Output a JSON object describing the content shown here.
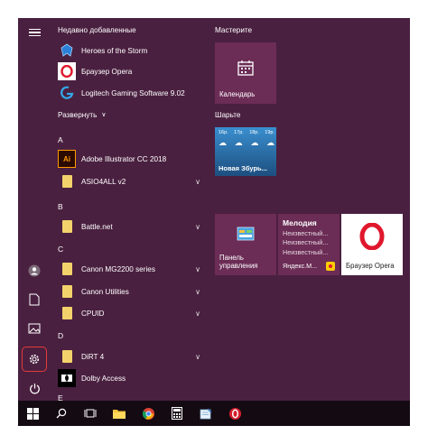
{
  "recent": {
    "title": "Недавно добавленные",
    "items": [
      {
        "label": "Heroes of the Storm",
        "icon": "heroes-of-the-storm-icon"
      },
      {
        "label": "Браузер Opera",
        "icon": "opera-icon"
      },
      {
        "label": "Logitech Gaming Software 9.02",
        "icon": "logitech-icon"
      }
    ]
  },
  "expand_label": "Развернуть",
  "sections": {
    "a": "A",
    "b": "B",
    "c": "C",
    "d": "D",
    "e": "E"
  },
  "apps": {
    "illustrator": "Adobe Illustrator CC 2018",
    "asio": "ASIO4ALL v2",
    "battlenet": "Battle.net",
    "canon_mg": "Canon MG2200 series",
    "canon_util": "Canon Utilities",
    "cpuid": "CPUID",
    "dirt": "DiRT 4",
    "dolby": "Dolby Access"
  },
  "groups": {
    "masterite": "Мастерите",
    "sharyte": "Шарьте"
  },
  "tiles": {
    "calendar": "Календарь",
    "weather_place": "Новая Збурь...",
    "weather_days": [
      "16р.",
      "17р.",
      "18р.",
      "19р."
    ],
    "control_panel": "Панель управления",
    "opera": "Браузер Opera",
    "music_title": "Мелодия",
    "music_lines": [
      "Неизвестный...",
      "Неизвестный...",
      "Неизвестный..."
    ],
    "yandex": "Яндекс.М..."
  },
  "colors": {
    "start_bg": "#4a2040",
    "tile_bg": "#6b2c55",
    "highlight": "#e23b3b",
    "opera_red": "#e0182d"
  }
}
